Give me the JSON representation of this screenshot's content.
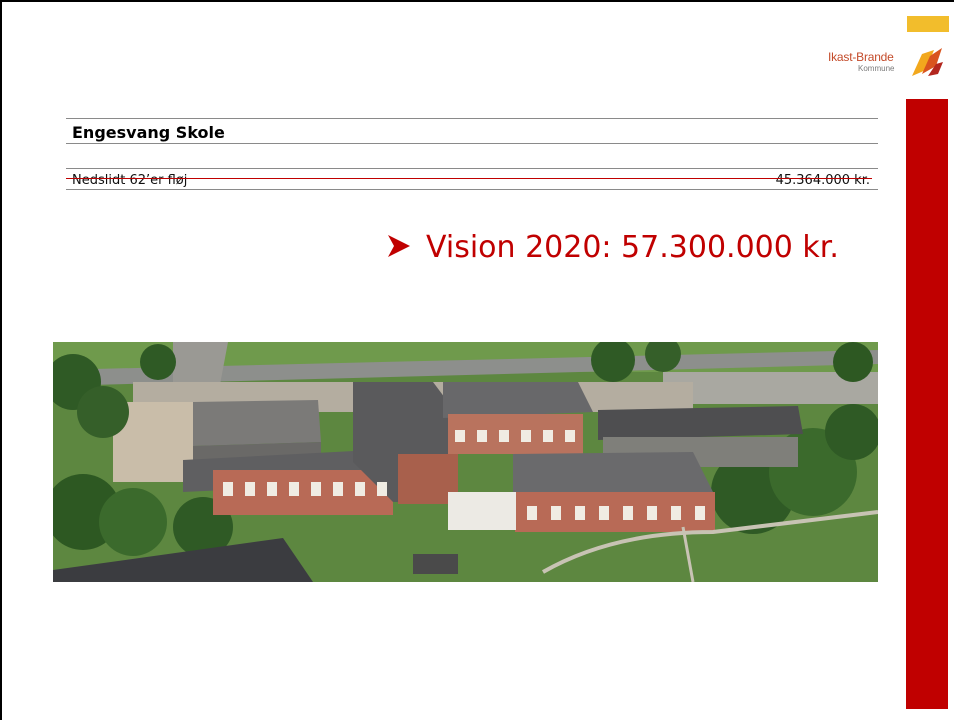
{
  "logo": {
    "name": "Ikast-Brande",
    "sub": "Kommune"
  },
  "heading": "Engesvang Skole",
  "item": {
    "label": "Nedslidt 62’er fløj",
    "amount": "45.364.000 kr."
  },
  "vision": "Vision 2020: 57.300.000 kr.",
  "colors": {
    "accent_red": "#c00000",
    "accent_yellow": "#f2bd2c"
  },
  "photo": {
    "description_icon": "aerial-school-photo"
  }
}
